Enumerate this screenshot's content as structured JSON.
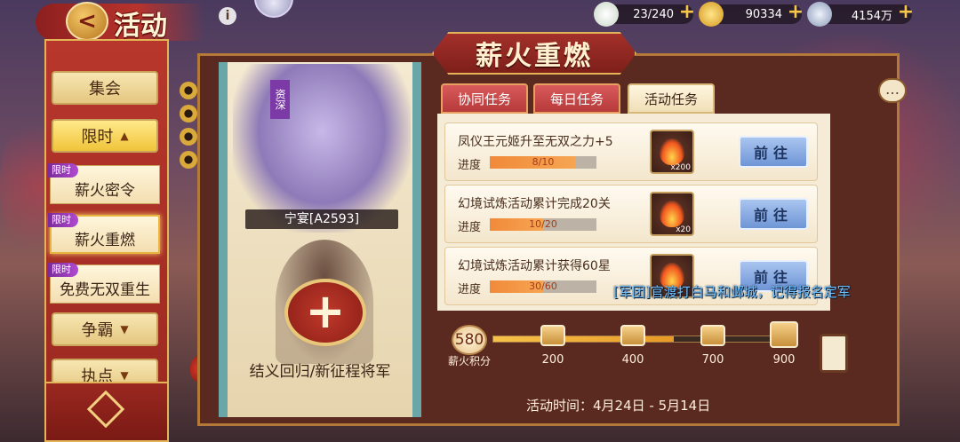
{
  "header": {
    "back_glyph": "<",
    "title": "活动",
    "info_glyph": "i"
  },
  "resources": [
    {
      "name": "stamina",
      "value": "23/240",
      "icon": "stamina-bowl-icon",
      "color": "#e7eee6"
    },
    {
      "name": "gold",
      "value": "90334",
      "icon": "gold-ingot-icon",
      "color": "#f2c23a"
    },
    {
      "name": "silver",
      "value": "4154万",
      "icon": "silver-coin-icon",
      "color": "#c8d2e6"
    }
  ],
  "sidebar": {
    "items": [
      {
        "label": "集会",
        "kind": "button"
      },
      {
        "label": "限时",
        "kind": "button-expanded",
        "arrow": "▲"
      },
      {
        "tag": "限时",
        "label": "薪火密令",
        "kind": "sub"
      },
      {
        "tag": "限时",
        "label": "薪火重燃",
        "kind": "sub-active"
      },
      {
        "tag": "限时",
        "label": "免费无双重生",
        "kind": "sub"
      },
      {
        "label": "争霸",
        "kind": "button-collapsed",
        "arrow": "▼"
      },
      {
        "label": "执点",
        "kind": "button-collapsed",
        "arrow": "▼"
      }
    ]
  },
  "main": {
    "title": "薪火重燃",
    "chat_glyph": "…"
  },
  "scroll": {
    "ribbon": "资深",
    "hero_name": "宁宴[A2593]",
    "plus_glyph": "+",
    "caption": "结义回归/新征程将军"
  },
  "tabs": [
    {
      "label": "协同任务",
      "active": false
    },
    {
      "label": "每日任务",
      "active": false
    },
    {
      "label": "活动任务",
      "active": true
    }
  ],
  "tasks": [
    {
      "title": "凤仪王元姬升至无双之力+5",
      "progress_label": "进度",
      "progress_text": "8/10",
      "progress": 0.8,
      "reward_qty": "x200",
      "button": "前往"
    },
    {
      "title": "幻境试炼活动累计完成20关",
      "progress_label": "进度",
      "progress_text": "10/20",
      "progress": 0.5,
      "reward_qty": "x20",
      "button": "前往"
    },
    {
      "title": "幻境试炼活动累计获得60星",
      "progress_label": "进度",
      "progress_text": "30/60",
      "progress": 0.5,
      "reward_qty": "",
      "button": "前往"
    }
  ],
  "marquee": "[军团]官渡打白马和邺城，记得报名定军",
  "score": {
    "value": "580",
    "label": "薪火积分",
    "track_progress": 0.62,
    "milestones": [
      "200",
      "400",
      "700",
      "900"
    ]
  },
  "event_time": "活动时间：4月24日 - 5月14日",
  "colors": {
    "accent_red": "#a3302a",
    "gold": "#e3b458",
    "button_blue": "#6e95d6",
    "marquee_blue": "#6ec0ff"
  }
}
